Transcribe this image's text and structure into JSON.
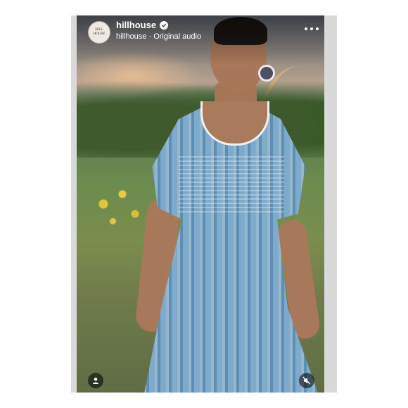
{
  "header": {
    "avatar_text": [
      "HILL",
      "HOUSE"
    ],
    "username": "hillhouse",
    "subtitle": "hillhouse · Original audio",
    "verified_icon": "verified-badge-icon",
    "more_icon": "more-options-icon"
  },
  "footer": {
    "tag_icon": "person-tag-icon",
    "mute_icon": "muted-speaker-icon"
  },
  "colors": {
    "overlay_text": "#ffffff",
    "dress_blue": "#6b9ac0"
  }
}
